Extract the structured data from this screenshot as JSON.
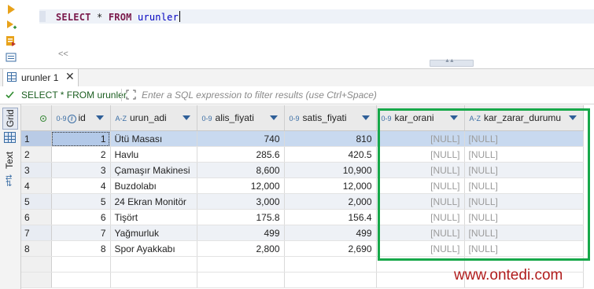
{
  "editor": {
    "sql_select": "SELECT",
    "sql_star": "*",
    "sql_from": "FROM",
    "sql_table": "urunler",
    "scroll_left": "<<"
  },
  "tab": {
    "label": "urunler 1",
    "close": "✕"
  },
  "filter": {
    "query_label": "SELECT * FROM urunler",
    "placeholder": "Enter a SQL expression to filter results (use Ctrl+Space)"
  },
  "side_panel": {
    "grid_label": "Grid",
    "text_label": "Text"
  },
  "grid": {
    "columns": [
      {
        "type": "0-9",
        "name": "id"
      },
      {
        "type": "A-Z",
        "name": "urun_adi"
      },
      {
        "type": "0-9",
        "name": "alis_fiyati"
      },
      {
        "type": "0-9",
        "name": "satis_fiyati"
      },
      {
        "type": "0-9",
        "name": "kar_orani"
      },
      {
        "type": "A-Z",
        "name": "kar_zarar_durumu"
      }
    ],
    "rows": [
      {
        "n": "1",
        "id": "1",
        "urun_adi": "Ütü Masası",
        "alis": "740",
        "satis": "810",
        "kar_orani": "[NULL]",
        "kar_zarar": "[NULL]"
      },
      {
        "n": "2",
        "id": "2",
        "urun_adi": "Havlu",
        "alis": "285.6",
        "satis": "420.5",
        "kar_orani": "[NULL]",
        "kar_zarar": "[NULL]"
      },
      {
        "n": "3",
        "id": "3",
        "urun_adi": "Çamaşır Makinesi",
        "alis": "8,600",
        "satis": "10,900",
        "kar_orani": "[NULL]",
        "kar_zarar": "[NULL]"
      },
      {
        "n": "4",
        "id": "4",
        "urun_adi": "Buzdolabı",
        "alis": "12,000",
        "satis": "12,000",
        "kar_orani": "[NULL]",
        "kar_zarar": "[NULL]"
      },
      {
        "n": "5",
        "id": "5",
        "urun_adi": "24 Ekran Monitör",
        "alis": "3,000",
        "satis": "2,000",
        "kar_orani": "[NULL]",
        "kar_zarar": "[NULL]"
      },
      {
        "n": "6",
        "id": "6",
        "urun_adi": "Tişört",
        "alis": "175.8",
        "satis": "156.4",
        "kar_orani": "[NULL]",
        "kar_zarar": "[NULL]"
      },
      {
        "n": "7",
        "id": "7",
        "urun_adi": "Yağmurluk",
        "alis": "499",
        "satis": "499",
        "kar_orani": "[NULL]",
        "kar_zarar": "[NULL]"
      },
      {
        "n": "8",
        "id": "8",
        "urun_adi": "Spor Ayakkabı",
        "alis": "2,800",
        "satis": "2,690",
        "kar_orani": "[NULL]",
        "kar_zarar": "[NULL]"
      }
    ]
  },
  "watermark": "www.ontedi.com",
  "colors": {
    "highlight": "#17a84a",
    "watermark": "#b01c1c",
    "selected_row": "#c8d9ef"
  }
}
